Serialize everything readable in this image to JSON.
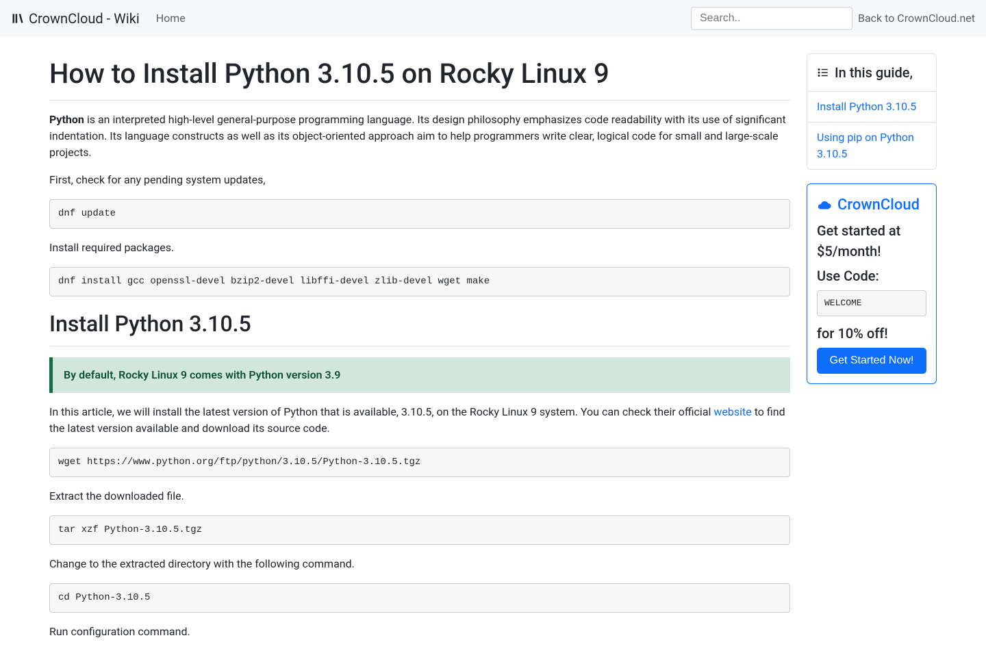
{
  "nav": {
    "brand": "CrownCloud - Wiki",
    "home": "Home",
    "search_placeholder": "Search..",
    "back": "Back to CrownCloud.net"
  },
  "article": {
    "title": "How to Install Python 3.10.5 on Rocky Linux 9",
    "intro_bold": "Python",
    "intro_rest": " is an interpreted high-level general-purpose programming language. Its design philosophy emphasizes code readability with its use of significant indentation. Its language constructs as well as its object-oriented approach aim to help programmers write clear, logical code for small and large-scale projects.",
    "p_check_updates": "First, check for any pending system updates,",
    "code_update": "dnf update",
    "p_install_pkgs": "Install required packages.",
    "code_install_pkgs": "dnf install gcc openssl-devel bzip2-devel libffi-devel zlib-devel wget make",
    "h2_install": "Install Python 3.10.5",
    "note_default": "By default, Rocky Linux 9 comes with Python version 3.9",
    "p_in_article_1": "In this article, we will install the latest version of Python that is available, 3.10.5, on the Rocky Linux 9 system. You can check their official ",
    "link_website": "website",
    "p_in_article_2": " to find the latest version available and download its source code.",
    "code_wget": "wget https://www.python.org/ftp/python/3.10.5/Python-3.10.5.tgz",
    "p_extract": "Extract the downloaded file.",
    "code_tar": "tar xzf Python-3.10.5.tgz",
    "p_cd": "Change to the extracted directory with the following command.",
    "code_cd": "cd Python-3.10.5",
    "p_configure": "Run configuration command."
  },
  "toc": {
    "header": "In this guide,",
    "items": [
      "Install Python 3.10.5",
      "Using pip on Python 3.10.5"
    ]
  },
  "promo": {
    "brand": "CrownCloud",
    "get_started": "Get started at $5/month!",
    "use_code": "Use Code:",
    "code": "WELCOME",
    "discount": "for 10% off!",
    "cta": "Get Started Now!"
  }
}
